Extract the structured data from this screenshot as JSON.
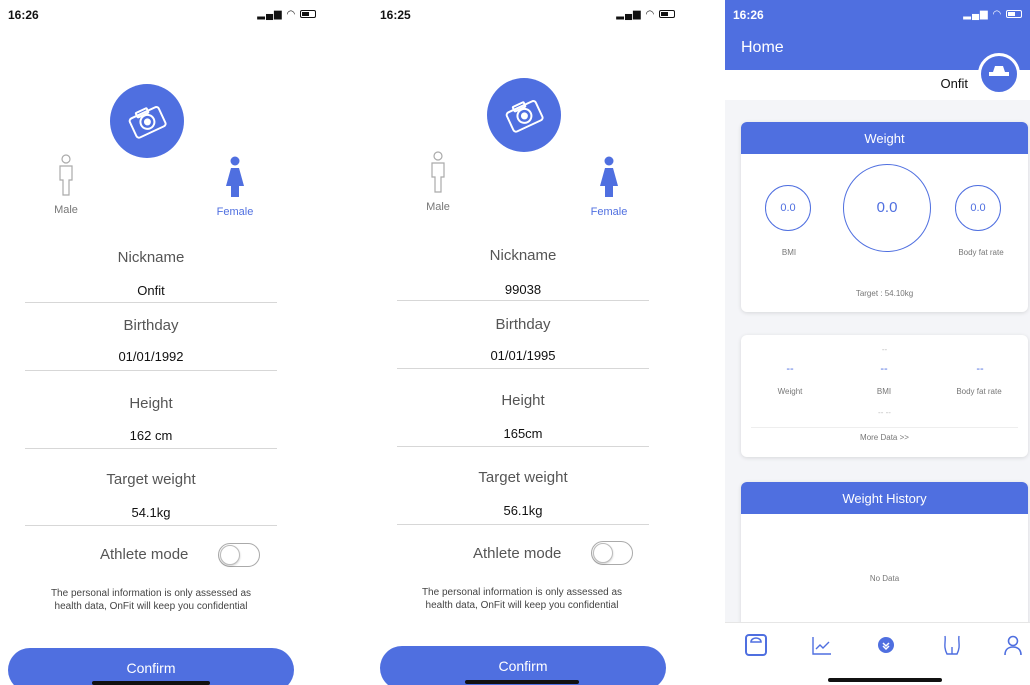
{
  "screens": [
    {
      "status_time": "16:26",
      "gender": {
        "male": "Male",
        "female": "Female",
        "selected": "female"
      },
      "fields": [
        {
          "label": "Nickname",
          "value": "Onfit"
        },
        {
          "label": "Birthday",
          "value": "01/01/1992"
        },
        {
          "label": "Height",
          "value": "162 cm"
        },
        {
          "label": "Target weight",
          "value": "54.1kg"
        }
      ],
      "athlete_label": "Athlete mode",
      "athlete_on": false,
      "note_line1": "The personal information is only assessed as",
      "note_line2": "health data, OnFit will keep you confidential",
      "confirm_label": "Confirm"
    },
    {
      "status_time": "16:25",
      "gender": {
        "male": "Male",
        "female": "Female",
        "selected": "female"
      },
      "fields": [
        {
          "label": "Nickname",
          "value": "99038"
        },
        {
          "label": "Birthday",
          "value": "01/01/1995"
        },
        {
          "label": "Height",
          "value": "165cm"
        },
        {
          "label": "Target weight",
          "value": "56.1kg"
        }
      ],
      "athlete_label": "Athlete mode",
      "athlete_on": false,
      "note_line1": "The personal information is only assessed as",
      "note_line2": "health data, OnFit will keep you confidential",
      "confirm_label": "Confirm"
    }
  ],
  "home": {
    "status_time": "16:26",
    "title": "Home",
    "user_name": "Onfit",
    "weight_card": {
      "title": "Weight",
      "bmi_value": "0.0",
      "weight_value": "0.0",
      "bodyfat_value": "0.0",
      "bmi_label": "BMI",
      "bodyfat_label": "Body fat rate",
      "target": "Target : 54.10kg"
    },
    "stats_card": {
      "top_dash": "--",
      "cols": [
        {
          "value": "--",
          "label": "Weight"
        },
        {
          "value": "--",
          "label": "BMI"
        },
        {
          "value": "--",
          "label": "Body fat rate"
        }
      ],
      "bottom_dash": "-- --",
      "more": "More Data >>"
    },
    "history_card": {
      "title": "Weight History",
      "empty": "No Data"
    },
    "tabs": [
      "scale-icon",
      "chart-icon",
      "home-icon",
      "body-icon",
      "profile-icon"
    ]
  },
  "colors": {
    "accent": "#4f6fe0",
    "text": "#333333",
    "muted": "#777777"
  }
}
